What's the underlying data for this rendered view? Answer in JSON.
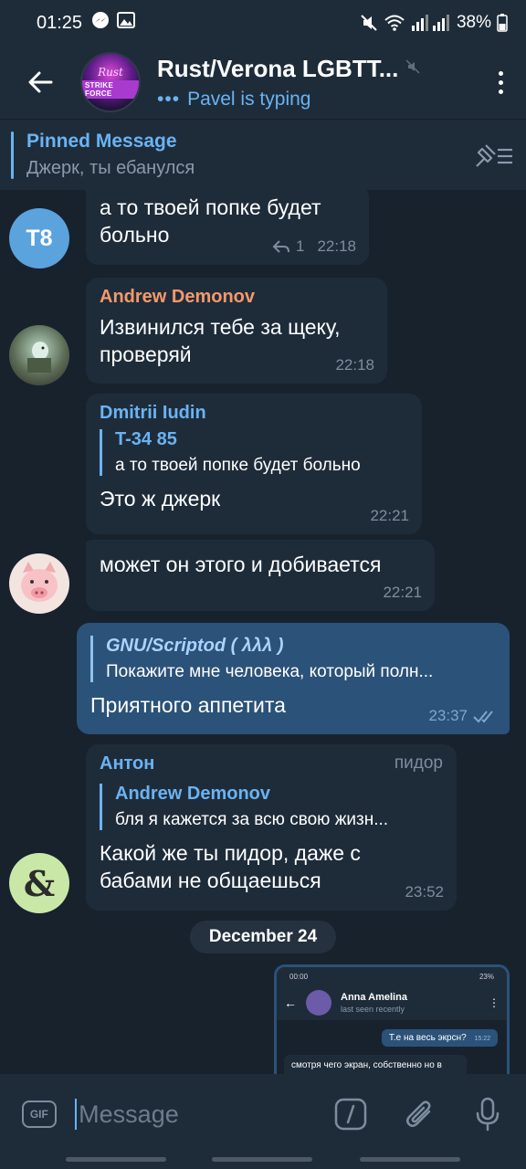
{
  "statusbar": {
    "time": "01:25",
    "battery": "38%"
  },
  "header": {
    "title": "Rust/Verona LGBTT...",
    "status_dots": "•••",
    "status": "Pavel is typing",
    "avatar_text_top": "Rust",
    "avatar_text_bottom": "STRIKE FORCE"
  },
  "pinned": {
    "title": "Pinned Message",
    "text": "Джерк, ты ебанулся"
  },
  "messages": {
    "m1": {
      "avatar": "T8",
      "text_line1": "а то твоей попке будет",
      "text_line2": "больно",
      "replies": "1",
      "time": "22:18"
    },
    "m2": {
      "sender": "Andrew Demonov",
      "text_line1": "Извинился тебе за щеку,",
      "text_line2": "проверяй",
      "time": "22:18"
    },
    "m3": {
      "sender": "Dmitrii Iudin",
      "reply_name": "T-34 85",
      "reply_text": "а то твоей попке будет больно",
      "text": "Это ж джерк",
      "time": "22:21"
    },
    "m4": {
      "text": "может он этого и добивается",
      "time": "22:21"
    },
    "m5": {
      "reply_name": "GNU/Scriptod ( λλλ )",
      "reply_text": "Покажите мне человека, который полн...",
      "text": "Приятного аппетита",
      "time": "23:37"
    },
    "m6": {
      "sender": "Антон",
      "sender_tag": "пидор",
      "avatar": "&",
      "reply_name": "Andrew Demonov",
      "reply_text": "бля я кажется за всю свою жизн...",
      "text_line1": "Какой же ты пидор, даже с",
      "text_line2": "бабами не общаешься",
      "time": "23:52"
    }
  },
  "date_chip": "December 24",
  "thumbnail": {
    "time": "00:00",
    "battery": "23%",
    "name": "Anna Amelina",
    "seen": "last seen recently",
    "out_text": "Т.е на весь экрсн?",
    "out_time": "15:22",
    "in_text": "смотря чего экран, собственно но в целом да"
  },
  "input": {
    "placeholder": "Message",
    "gif_label": "GIF"
  },
  "colors": {
    "accent": "#6ab3f3",
    "andrew": "#f5996b",
    "dmitrii": "#6ab3f3",
    "anton": "#6ab3f3",
    "outgoing": "#2b5278",
    "incoming": "#1e2c3a"
  }
}
